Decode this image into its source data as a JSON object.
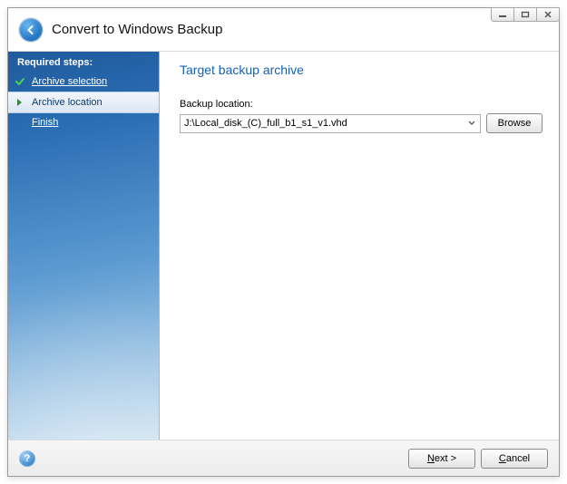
{
  "header": {
    "title": "Convert to Windows Backup"
  },
  "sidebar": {
    "heading": "Required steps:",
    "items": [
      {
        "label": "Archive selection",
        "state": "done"
      },
      {
        "label": "Archive location",
        "state": "current"
      },
      {
        "label": "Finish",
        "state": "pending"
      }
    ]
  },
  "main": {
    "title": "Target backup archive",
    "field_label": "Backup location:",
    "location_value": "J:\\Local_disk_(C)_full_b1_s1_v1.vhd",
    "browse_label": "Browse"
  },
  "footer": {
    "next_prefix": "N",
    "next_rest": "ext >",
    "cancel_prefix": "C",
    "cancel_rest": "ancel"
  }
}
